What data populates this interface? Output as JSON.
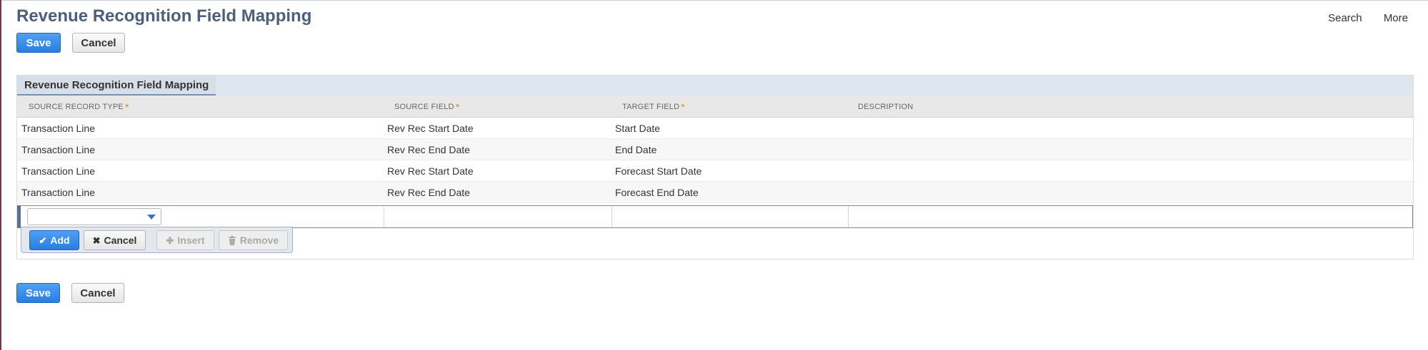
{
  "page": {
    "title": "Revenue Recognition Field Mapping",
    "nav_links": [
      "Search",
      "More"
    ]
  },
  "toolbar": {
    "save_label": "Save",
    "cancel_label": "Cancel"
  },
  "section": {
    "title": "Revenue Recognition Field Mapping",
    "columns": [
      {
        "label": "SOURCE RECORD TYPE",
        "required": true
      },
      {
        "label": "SOURCE FIELD",
        "required": true
      },
      {
        "label": "TARGET FIELD",
        "required": true
      },
      {
        "label": "DESCRIPTION",
        "required": false
      }
    ],
    "required_marker": "*",
    "rows": [
      {
        "source_record_type": "Transaction Line",
        "source_field": "Rev Rec Start Date",
        "target_field": "Start Date",
        "description": ""
      },
      {
        "source_record_type": "Transaction Line",
        "source_field": "Rev Rec End Date",
        "target_field": "End Date",
        "description": ""
      },
      {
        "source_record_type": "Transaction Line",
        "source_field": "Rev Rec Start Date",
        "target_field": "Forecast Start Date",
        "description": ""
      },
      {
        "source_record_type": "Transaction Line",
        "source_field": "Rev Rec End Date",
        "target_field": "Forecast End Date",
        "description": ""
      }
    ],
    "line_buttons": {
      "add": "Add",
      "cancel": "Cancel",
      "insert": "Insert",
      "remove": "Remove"
    }
  },
  "icons": {
    "add": "check-icon",
    "cancel": "x-icon",
    "insert": "plus-icon",
    "remove": "trash-icon"
  },
  "colors": {
    "title": "#4d5f79",
    "primary_button": "#2a7ee0",
    "required_star": "#e58b00",
    "section_header": "#e0e6ef"
  }
}
